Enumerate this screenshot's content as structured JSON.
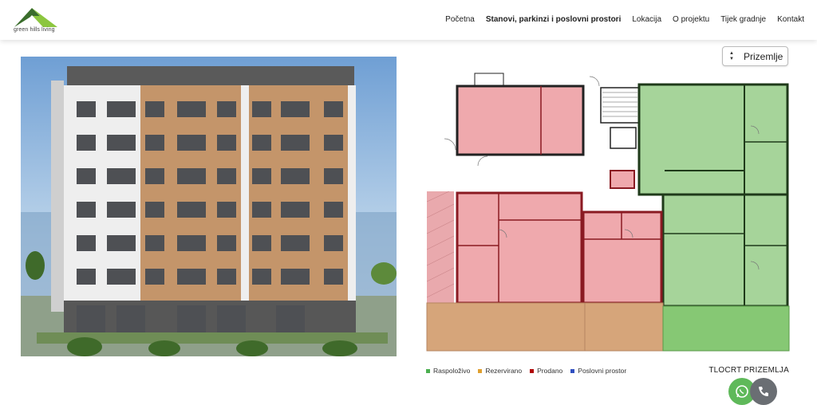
{
  "logo": {
    "text": "green hills living"
  },
  "nav": {
    "items": [
      "Početna",
      "Stanovi, parkinzi i poslovni prostori",
      "Lokacija",
      "O projektu",
      "Tijek gradnje",
      "Kontakt"
    ],
    "active_index": 1
  },
  "floor_selector": {
    "value": "Prizemlje"
  },
  "legend": [
    {
      "label": "Raspoloživo",
      "color": "#4caf50"
    },
    {
      "label": "Rezervirano",
      "color": "#e0a030"
    },
    {
      "label": "Prodano",
      "color": "#b00000"
    },
    {
      "label": "Poslovni prostor",
      "color": "#3050c0"
    }
  ],
  "plan_caption": "TLOCRT PRIZEMLJA",
  "colors": {
    "sold_fill": "#efa9ad",
    "available_fill": "#a6d49a",
    "reserved_fill": "#d6a57a",
    "available_ground": "#86c874",
    "wall": "#222222"
  },
  "icons": [
    "whatsapp-icon",
    "phone-icon",
    "chevron-up-icon",
    "chevron-down-icon"
  ]
}
